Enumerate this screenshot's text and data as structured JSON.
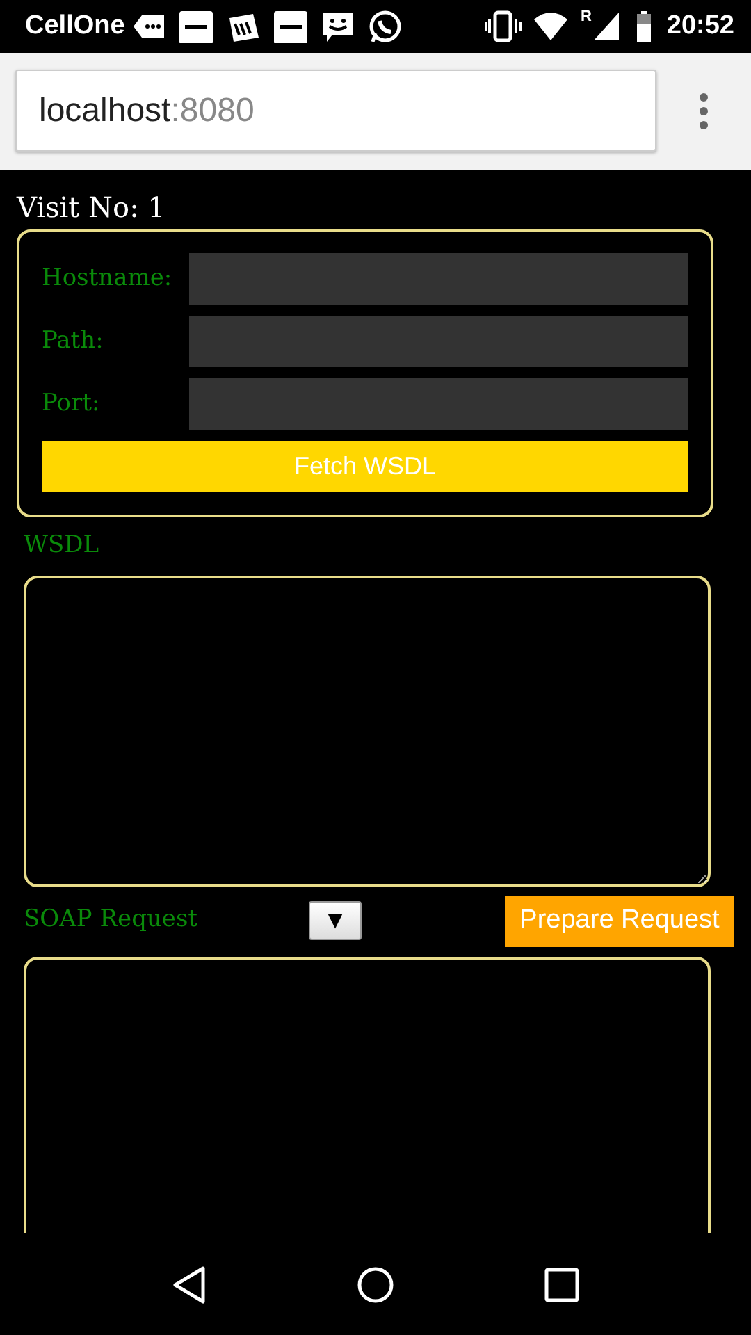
{
  "status_bar": {
    "carrier": "CellOne",
    "time": "20:52",
    "roaming_mark": "R"
  },
  "browser": {
    "url_host": "localhost",
    "url_port": ":8080"
  },
  "visit": "Visit No: 1",
  "form": {
    "fields": [
      {
        "label": "Hostname:"
      },
      {
        "label": "Path:"
      },
      {
        "label": "Port:"
      }
    ],
    "button": "Fetch WSDL"
  },
  "wsdl": {
    "label": "WSDL"
  },
  "soap": {
    "label": "SOAP Request",
    "select_arrow": "▼",
    "button": "Prepare Request"
  }
}
